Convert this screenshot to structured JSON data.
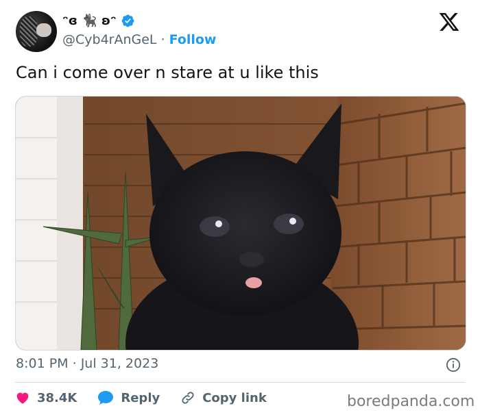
{
  "author": {
    "display_name": "ᵔɞ 🐈‍⬛ ʚᵔ",
    "handle": "@Cyb4rAnGeL",
    "separator": "·",
    "follow_label": "Follow"
  },
  "tweet": {
    "text": "Can i come over n stare at u like this",
    "time": "8:01 PM",
    "date": "Jul 31, 2023",
    "meta_separator": "·"
  },
  "actions": {
    "likes": "38.4K",
    "reply_label": "Reply",
    "copy_label": "Copy link"
  },
  "watermark": "boredpanda.com",
  "colors": {
    "accent": "#1d9bf0",
    "like": "#f91880",
    "secondary_text": "#536471"
  }
}
